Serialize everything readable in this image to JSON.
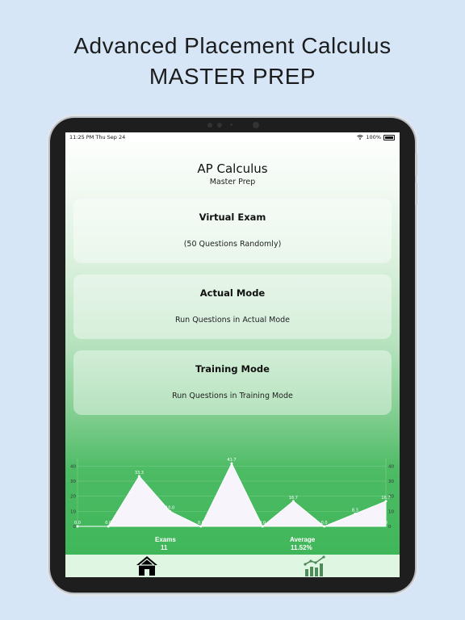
{
  "headline": {
    "line1": "Advanced Placement Calculus",
    "line2": "MASTER PREP"
  },
  "status_bar": {
    "time": "11:25 PM   Thu Sep 24",
    "battery": "100%"
  },
  "app": {
    "title": "AP Calculus",
    "subtitle": "Master Prep"
  },
  "cards": [
    {
      "title": "Virtual Exam",
      "description": "(50 Questions Randomly)"
    },
    {
      "title": "Actual Mode",
      "description": "Run Questions in Actual Mode"
    },
    {
      "title": "Training Mode",
      "description": "Run Questions in Training Mode"
    }
  ],
  "stats": {
    "exams_label": "Exams",
    "exams_value": "11",
    "average_label": "Average",
    "average_value": "11.52%"
  },
  "tabs": [
    {
      "icon": "home-icon"
    },
    {
      "icon": "chart-icon"
    }
  ],
  "colors": {
    "accent": "#3db557",
    "chart_fill": "#f7f5fb"
  },
  "chart_data": {
    "type": "area",
    "x": [
      1,
      2,
      3,
      4,
      5,
      6,
      7,
      8,
      9,
      10,
      11
    ],
    "values": [
      0.0,
      0.0,
      33.3,
      10.0,
      0.0,
      41.7,
      0.0,
      16.7,
      0.0,
      8.3,
      16.7
    ],
    "data_labels": [
      "0.0",
      "0.0",
      "33.3",
      "10.0",
      "0.0",
      "41.7",
      "0.0",
      "16.7",
      "0.0",
      "8.3",
      "16.7"
    ],
    "extra_label": "0.0",
    "y_ticks": [
      "0",
      "10",
      "20",
      "30",
      "40"
    ],
    "ylim": [
      0,
      45
    ],
    "grid": true,
    "legend": "none"
  }
}
